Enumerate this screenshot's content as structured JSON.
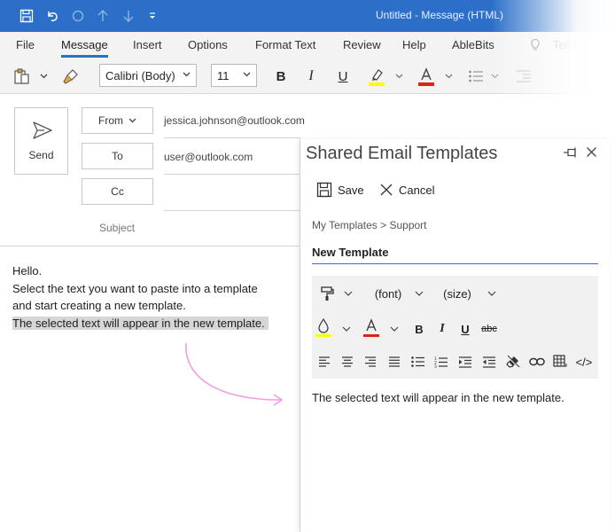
{
  "window": {
    "title": "Untitled  -  Message (HTML)"
  },
  "quick_access": [
    {
      "icon": "save-icon"
    },
    {
      "icon": "undo-icon"
    },
    {
      "icon": "redo-icon"
    },
    {
      "icon": "up-arrow-icon"
    },
    {
      "icon": "down-arrow-icon"
    },
    {
      "icon": "customize-icon"
    }
  ],
  "menu": {
    "tabs": [
      {
        "label": "File"
      },
      {
        "label": "Message"
      },
      {
        "label": "Insert"
      },
      {
        "label": "Options"
      },
      {
        "label": "Format Text"
      },
      {
        "label": "Review"
      },
      {
        "label": "Help"
      },
      {
        "label": "AbleBits"
      },
      {
        "label": "Tell me"
      }
    ],
    "active": "Message"
  },
  "ribbon": {
    "font": "Calibri (Body)",
    "size": "11",
    "bold": "B",
    "italic": "I",
    "underline": "U",
    "highlight_color": "#ffff00",
    "font_color": "#e0201c"
  },
  "compose": {
    "send_label": "Send",
    "from_label": "From",
    "to_label": "To",
    "cc_label": "Cc",
    "subject_label": "Subject",
    "from_value": "jessica.johnson@outlook.com",
    "to_value": "user@outlook.com",
    "body": {
      "line1": "Hello.",
      "line2": "Select the text you want to paste into a template",
      "line3": "and start creating a new template.",
      "line4": "The selected text will appear in the new template."
    }
  },
  "panel": {
    "title": "Shared Email Templates",
    "save_label": "Save",
    "cancel_label": "Cancel",
    "breadcrumb": "My Templates > Support",
    "template_name": "New Template",
    "toolbar": {
      "font": "(font)",
      "size": "(size)",
      "bold": "B",
      "italic": "I",
      "underline": "U",
      "strike": "abc",
      "code": "</>"
    },
    "preview_text": "The selected text will appear in the new template."
  },
  "colors": {
    "accent": "#2b6fc8",
    "arrow": "#f29ae6",
    "highlight": "#ffff00",
    "font_red": "#e0201c"
  }
}
